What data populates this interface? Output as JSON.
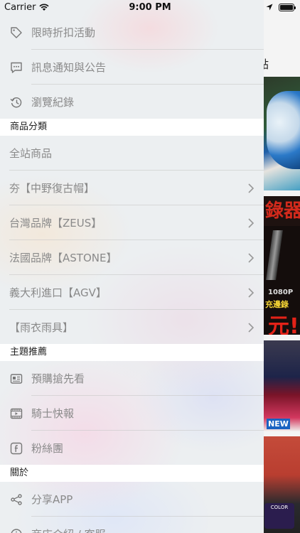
{
  "status_bar": {
    "carrier": "Carrier",
    "time": "9:00 PM",
    "battery_level": 1.0
  },
  "background": {
    "partial_text": "點",
    "promo_header": "錄器",
    "promo_line1": "1080P",
    "promo_line2": "充邊錄",
    "promo_price": "元!",
    "badge": "NEW",
    "color_tag": "COLOR"
  },
  "menu": {
    "top_items": [
      {
        "label": "限時折扣活動",
        "icon": "tag-icon"
      },
      {
        "label": "訊息通知與公告",
        "icon": "message-icon"
      },
      {
        "label": "瀏覽紀錄",
        "icon": "history-icon"
      }
    ],
    "sections": {
      "categories": "商品分類",
      "featured": "主題推薦",
      "about": "關於"
    },
    "category_items": [
      {
        "label": "全站商品"
      },
      {
        "label": "夯【中野復古帽】"
      },
      {
        "label": "台灣品牌【ZEUS】"
      },
      {
        "label": "法國品牌【ASTONE】"
      },
      {
        "label": "義大利進口【AGV】"
      },
      {
        "label": "【雨衣雨具】"
      }
    ],
    "featured_items": [
      {
        "label": "預購搶先看",
        "icon": "newspaper-icon"
      },
      {
        "label": "騎士快報",
        "icon": "video-icon"
      },
      {
        "label": "粉絲團",
        "icon": "facebook-icon"
      }
    ],
    "about_items": [
      {
        "label": "分享APP",
        "icon": "share-icon"
      },
      {
        "label": "商店介紹 / 客服",
        "icon": "info-icon"
      }
    ]
  }
}
